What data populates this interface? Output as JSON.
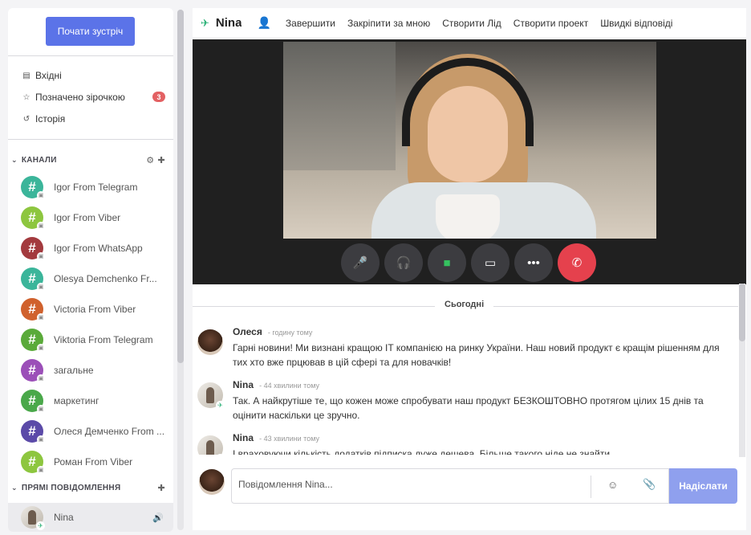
{
  "sidebar": {
    "start_button": "Почати зустріч",
    "nav": [
      {
        "label": "Вхідні",
        "icon": "inbox-icon"
      },
      {
        "label": "Позначено зірочкою",
        "icon": "star-icon",
        "badge": "3"
      },
      {
        "label": "Історія",
        "icon": "history-icon"
      }
    ],
    "channels_header": "КАНАЛИ",
    "channels": [
      {
        "name": "Igor From Telegram",
        "color": "#3bb59a"
      },
      {
        "name": "Igor From Viber",
        "color": "#8dc63f"
      },
      {
        "name": "Igor From WhatsApp",
        "color": "#a33a3e"
      },
      {
        "name": "Olesya Demchenko Fr...",
        "color": "#3bb59a"
      },
      {
        "name": "Victoria From Viber",
        "color": "#d0612d"
      },
      {
        "name": "Viktoria From Telegram",
        "color": "#5aaa3a"
      },
      {
        "name": "загальне",
        "color": "#9b4fb8"
      },
      {
        "name": "маркетинг",
        "color": "#4aa84a"
      },
      {
        "name": "Олеся Демченко From ...",
        "color": "#5b4aa8"
      },
      {
        "name": "Роман From Viber",
        "color": "#8dc63f"
      }
    ],
    "dm_header": "ПРЯМІ ПОВІДОМЛЕННЯ",
    "dm": [
      {
        "name": "Nina"
      }
    ]
  },
  "header": {
    "title": "Nina",
    "actions": [
      "Завершити",
      "Закріпити за мною",
      "Створити Лід",
      "Створити проект",
      "Швидкі відповіді"
    ]
  },
  "call_controls": [
    "microphone-icon",
    "headphones-icon",
    "camera-icon",
    "screen-share-icon",
    "more-icon",
    "hang-up-icon"
  ],
  "day_divider": "Сьогодні",
  "messages": [
    {
      "author": "Олеся",
      "time": "- годину тому",
      "text": "Гарні новини! Ми визнані кращою IT компанією на ринку України. Наш новий продукт є кращім рішенням для тих хто вже прцював в цій сфері та для новачків!"
    },
    {
      "author": "Nina",
      "time": "- 44 хвилини тому",
      "text": "Так. А найкрутіше те, що кожен може спробувати наш продукт БЕЗКОШТОВНО протягом цілих 15 днів та оцінити наскільки це зручно."
    },
    {
      "author": "Nina",
      "time": "- 43 хвилини тому",
      "text": "І враховуючи кількість додатків підписка дуже дешева. Більше такого ніде не знайти."
    }
  ],
  "composer": {
    "placeholder": "Повідомлення Nina...",
    "send_label": "Надіслати"
  }
}
